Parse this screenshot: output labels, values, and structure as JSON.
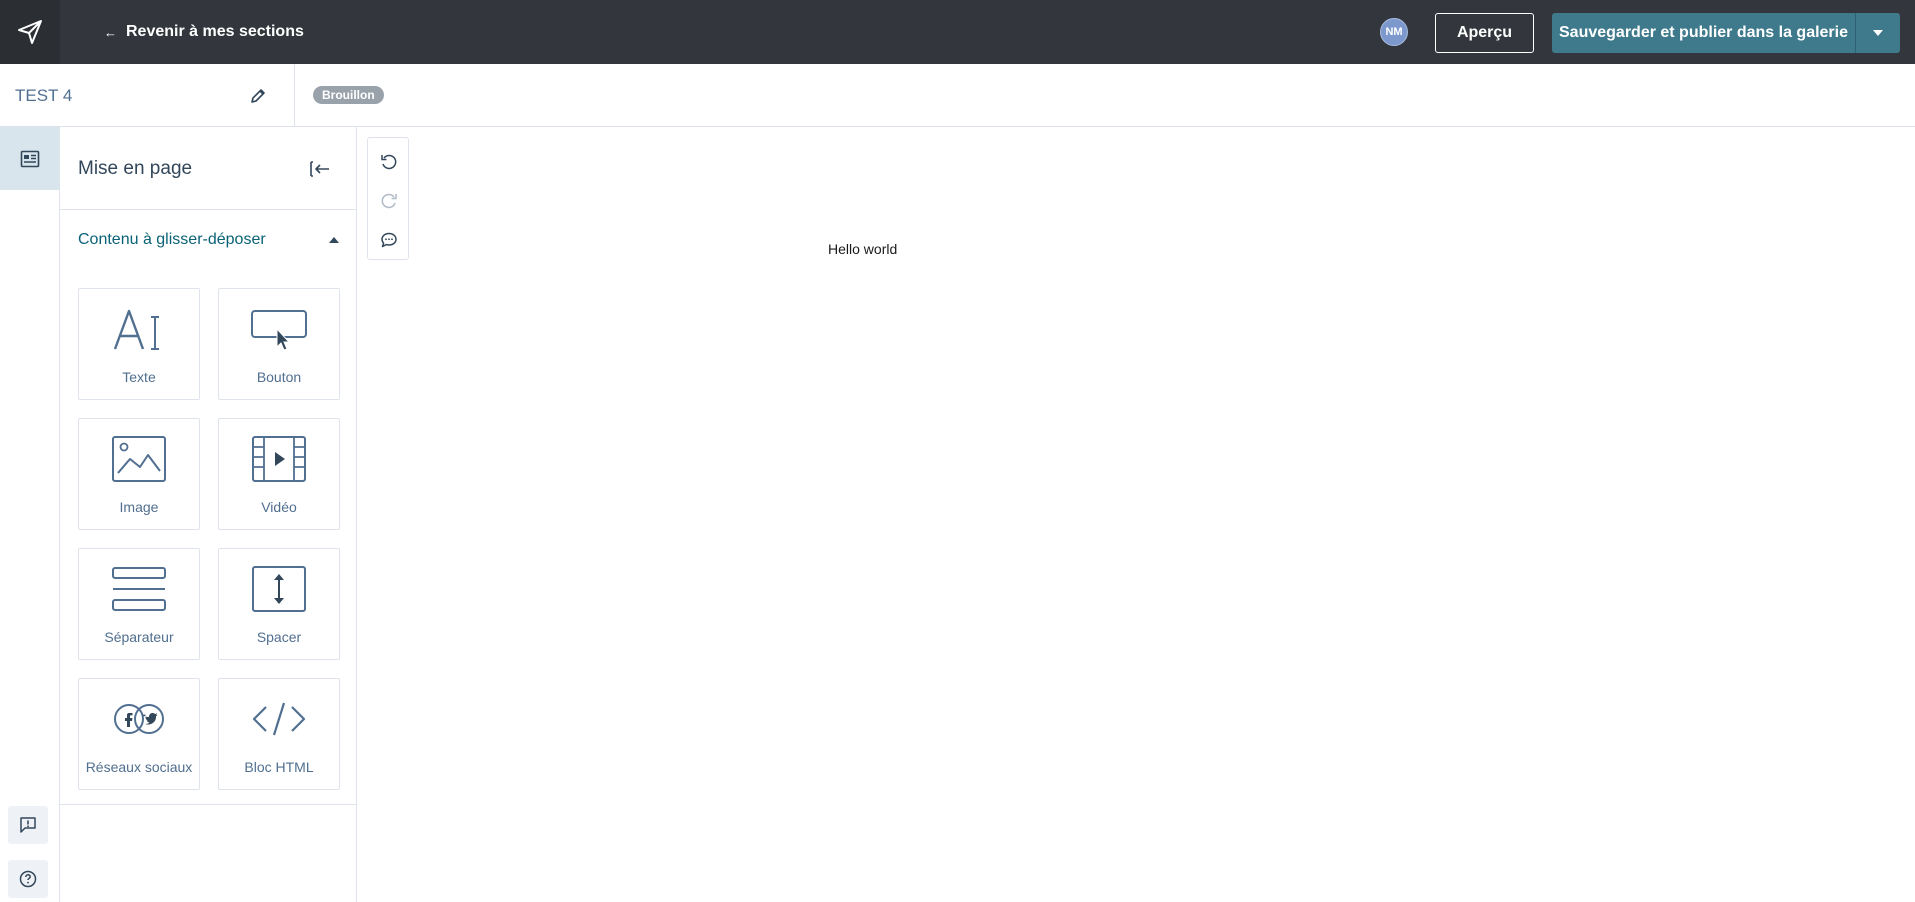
{
  "topbar": {
    "back_label": "Revenir à mes sections",
    "back_arrow": "←",
    "avatar_initials": "NM",
    "preview_label": "Aperçu",
    "publish_label": "Sauvegarder et publier dans la galerie"
  },
  "subbar": {
    "document_name": "TEST 4",
    "status_badge": "Brouillon"
  },
  "panel": {
    "title": "Mise en page",
    "section_label": "Contenu à glisser-déposer",
    "tiles": [
      {
        "label": "Texte",
        "icon": "text-icon"
      },
      {
        "label": "Bouton",
        "icon": "button-icon"
      },
      {
        "label": "Image",
        "icon": "image-icon"
      },
      {
        "label": "Vidéo",
        "icon": "video-icon"
      },
      {
        "label": "Séparateur",
        "icon": "divider-icon"
      },
      {
        "label": "Spacer",
        "icon": "spacer-icon"
      },
      {
        "label": "Réseaux sociaux",
        "icon": "social-icon"
      },
      {
        "label": "Bloc HTML",
        "icon": "html-icon"
      }
    ]
  },
  "canvas": {
    "content_text": "Hello world"
  },
  "colors": {
    "topbar_bg": "#33373d",
    "publish_bg": "#3e7a8c",
    "accent_text": "#0b6277",
    "badge_bg": "#99a2ab"
  }
}
